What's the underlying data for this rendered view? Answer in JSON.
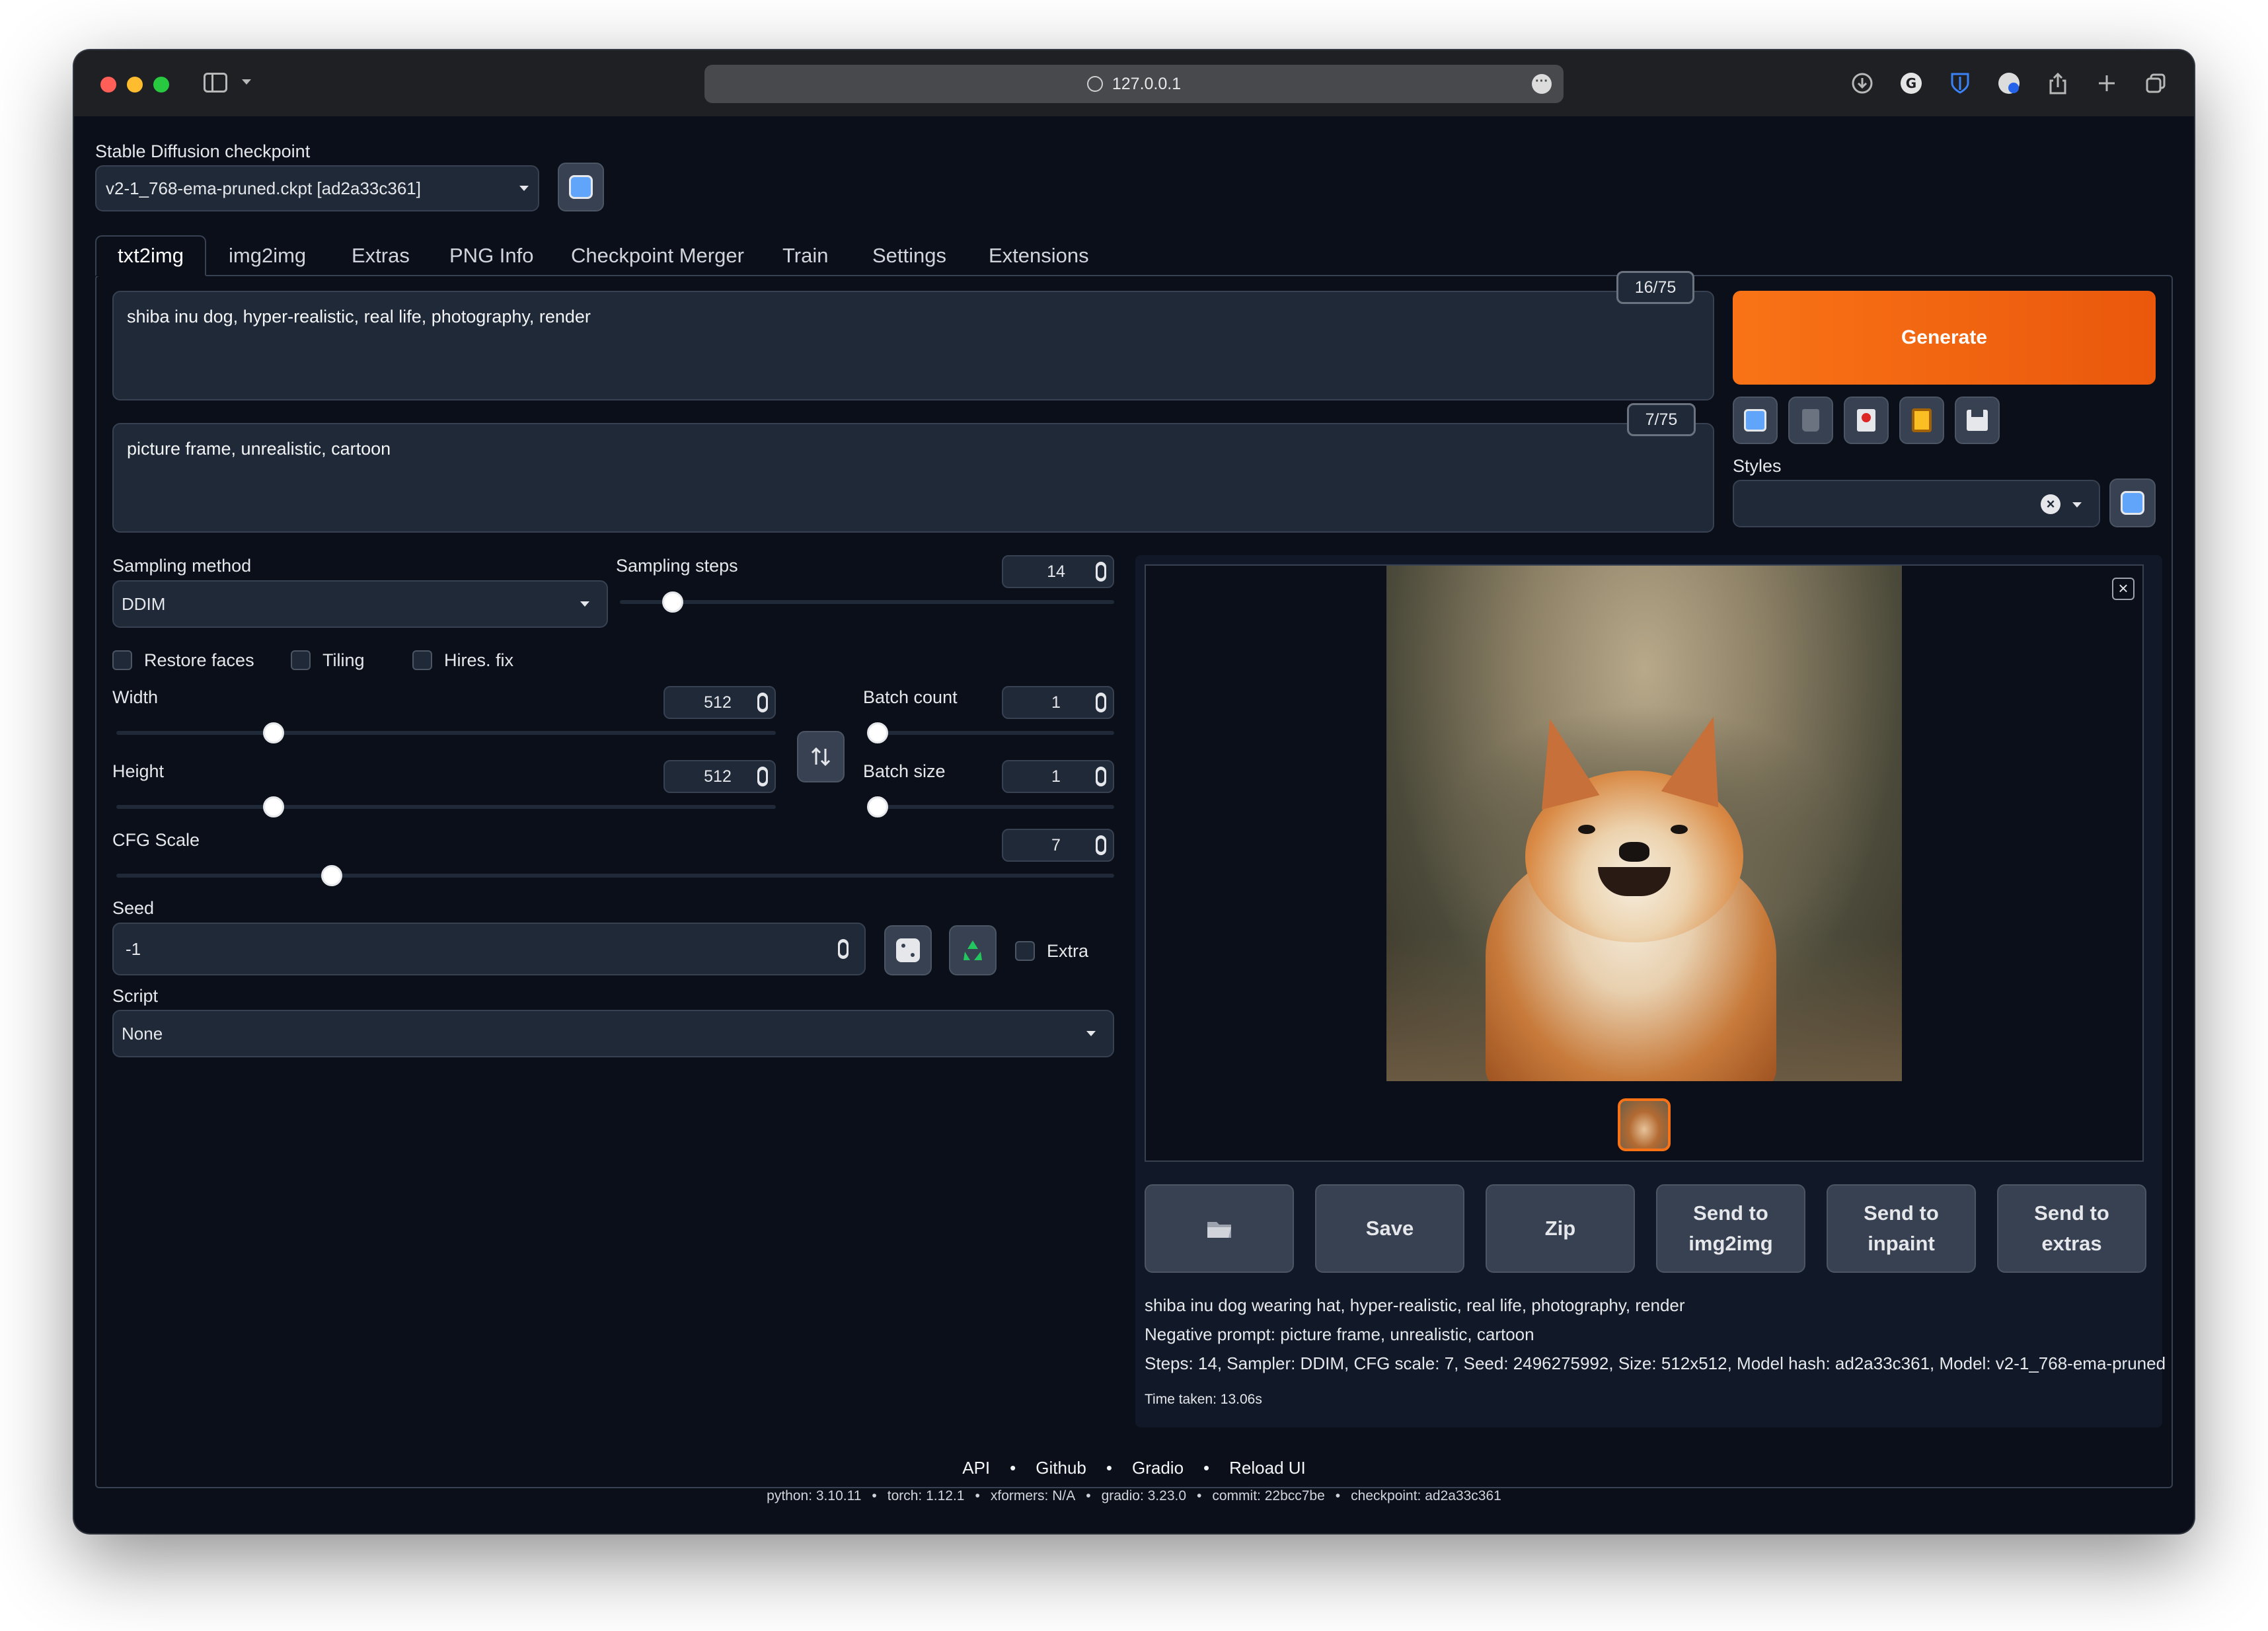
{
  "browser": {
    "url": "127.0.0.1",
    "icons": [
      "sidebar-icon",
      "chevron-down-icon",
      "globe-icon",
      "more-icon",
      "download-icon",
      "grammarly-icon",
      "bitwarden-icon",
      "extension-icon",
      "share-icon",
      "plus-icon",
      "tabs-icon"
    ]
  },
  "checkpoint": {
    "label": "Stable Diffusion checkpoint",
    "value": "v2-1_768-ema-pruned.ckpt [ad2a33c361]"
  },
  "tabs": [
    "txt2img",
    "img2img",
    "Extras",
    "PNG Info",
    "Checkpoint Merger",
    "Train",
    "Settings",
    "Extensions"
  ],
  "active_tab": "txt2img",
  "prompt": {
    "text": "shiba inu dog, hyper-realistic, real life, photography, render",
    "counter": "16/75"
  },
  "negative_prompt": {
    "text": "picture frame, unrealistic, cartoon",
    "counter": "7/75"
  },
  "generate_label": "Generate",
  "styles_label": "Styles",
  "sampling": {
    "method_label": "Sampling method",
    "method_value": "DDIM",
    "steps_label": "Sampling steps",
    "steps_value": "14",
    "steps_fraction": 0.09
  },
  "checkboxes": {
    "restore_faces": "Restore faces",
    "tiling": "Tiling",
    "hires_fix": "Hires. fix"
  },
  "width": {
    "label": "Width",
    "value": "512",
    "fraction": 0.23
  },
  "height": {
    "label": "Height",
    "value": "512",
    "fraction": 0.23
  },
  "batch_count": {
    "label": "Batch count",
    "value": "1",
    "fraction": 0.0
  },
  "batch_size": {
    "label": "Batch size",
    "value": "1",
    "fraction": 0.0
  },
  "cfg": {
    "label": "CFG Scale",
    "value": "7",
    "fraction": 0.21
  },
  "seed": {
    "label": "Seed",
    "value": "-1",
    "extra_label": "Extra"
  },
  "script": {
    "label": "Script",
    "value": "None"
  },
  "actions": {
    "folder_icon": "folder-icon",
    "save": "Save",
    "zip": "Zip",
    "send_img2img": "Send to img2img",
    "send_inpaint": "Send to inpaint",
    "send_extras": "Send to extras"
  },
  "info": {
    "prompt": "shiba inu dog wearing hat, hyper-realistic, real life, photography, render",
    "negative": "Negative prompt: picture frame, unrealistic, cartoon",
    "params": "Steps: 14, Sampler: DDIM, CFG scale: 7, Seed: 2496275992, Size: 512x512, Model hash: ad2a33c361, Model: v2-1_768-ema-pruned",
    "time": "Time taken: 13.06s"
  },
  "footer": {
    "links": [
      "API",
      "Github",
      "Gradio",
      "Reload UI"
    ],
    "separator": "•",
    "versions": [
      "python: 3.10.11",
      "torch: 1.12.1",
      "xformers: N/A",
      "gradio: 3.23.0",
      "commit: 22bcc7be",
      "checkpoint: ad2a33c361"
    ]
  },
  "colors": {
    "background": "#0b0f19",
    "panel": "#1f2937",
    "accent": "#f97316",
    "titlebar": "#1f2023"
  }
}
